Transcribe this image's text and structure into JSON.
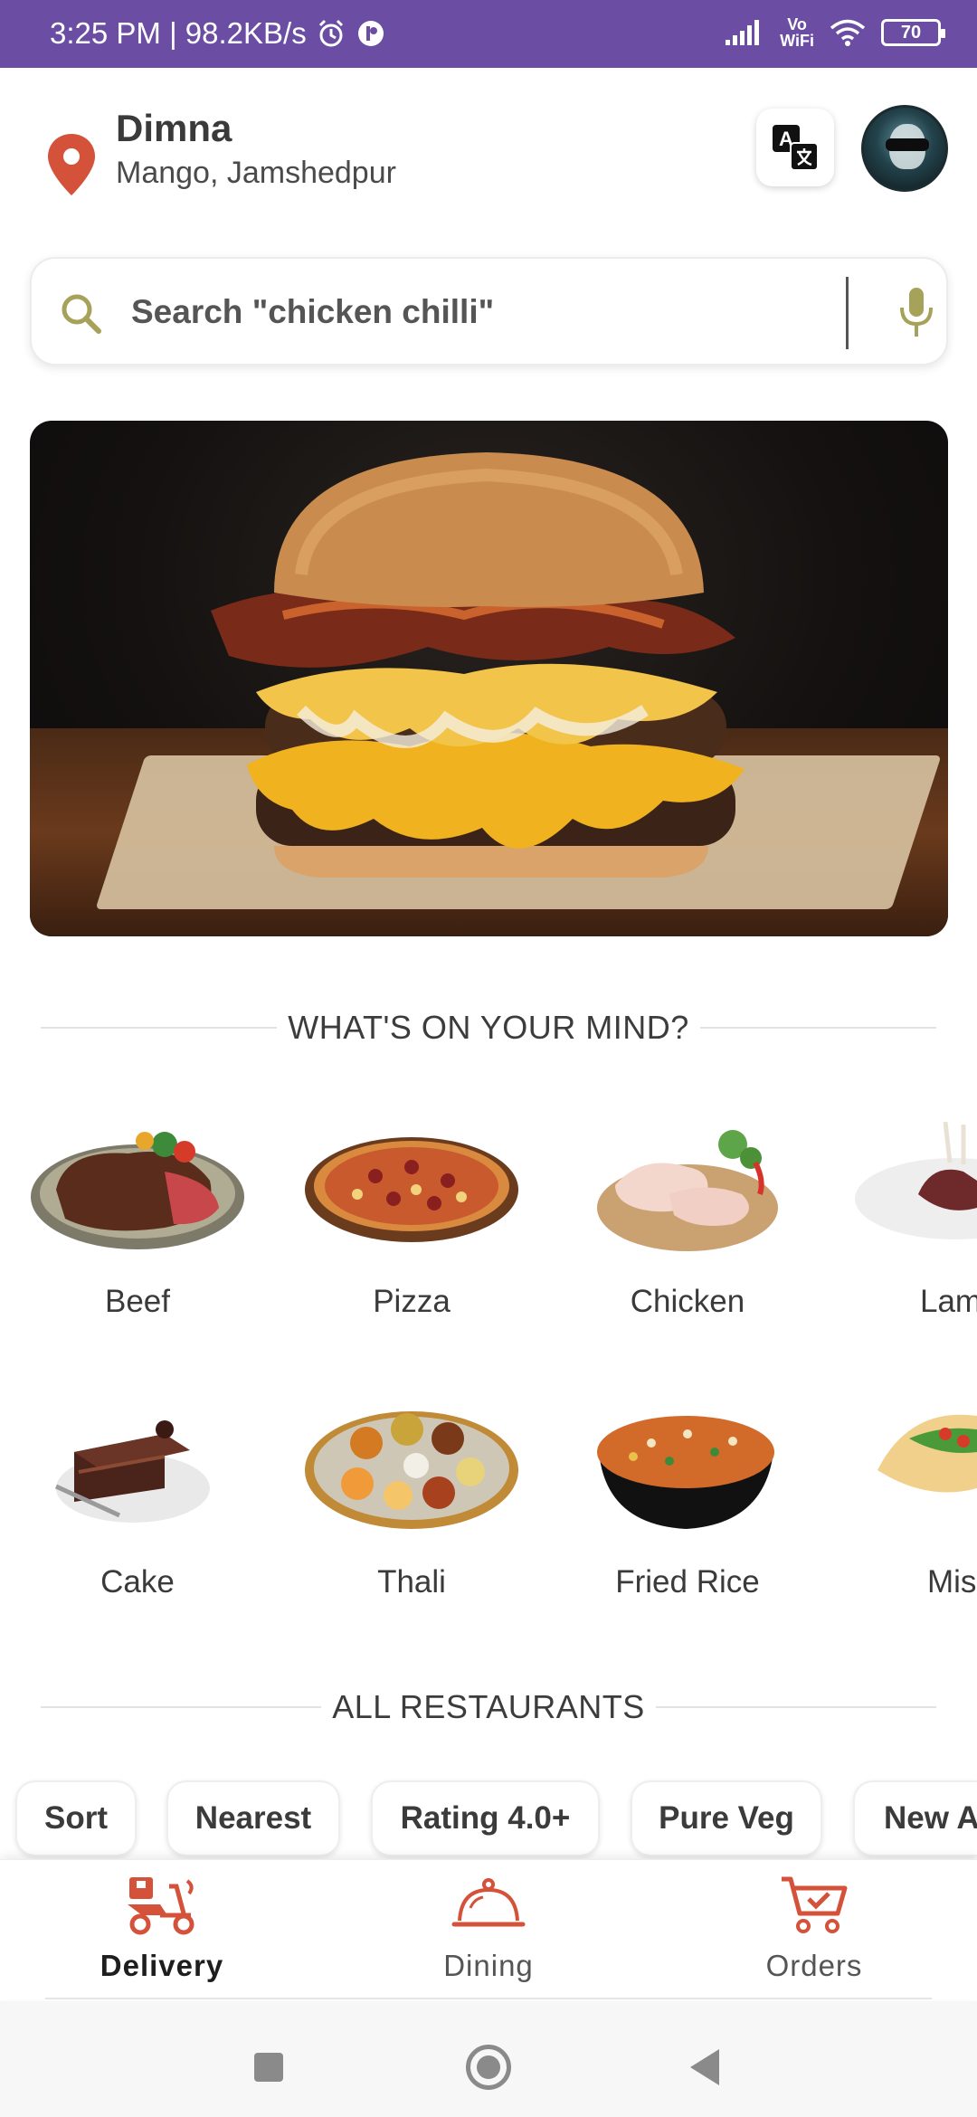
{
  "status_bar": {
    "left_text": "3:25 PM | 98.2KB/s",
    "vowifi_top": "Vo",
    "vowifi_bottom": "WiFi",
    "battery": "70"
  },
  "header": {
    "location_title": "Dimna",
    "location_subtitle": "Mango, Jamshedpur"
  },
  "search": {
    "placeholder": "Search \"chicken chilli\""
  },
  "sections": {
    "mind_title": "WHAT'S ON YOUR MIND?",
    "restaurants_title": "ALL RESTAURANTS"
  },
  "categories": [
    {
      "label": "Beef"
    },
    {
      "label": "Pizza"
    },
    {
      "label": "Chicken"
    },
    {
      "label": "Lam"
    },
    {
      "label": "Cake"
    },
    {
      "label": "Thali"
    },
    {
      "label": "Fried Rice"
    },
    {
      "label": "Mis"
    }
  ],
  "filters": [
    "Sort",
    "Nearest",
    "Rating 4.0+",
    "Pure Veg",
    "New A"
  ],
  "bottom_nav": [
    {
      "label": "Delivery",
      "active": true
    },
    {
      "label": "Dining",
      "active": false
    },
    {
      "label": "Orders",
      "active": false
    }
  ],
  "colors": {
    "status_bar": "#6b4ea3",
    "accent": "#d4513a",
    "search_icon": "#a6a25a"
  }
}
